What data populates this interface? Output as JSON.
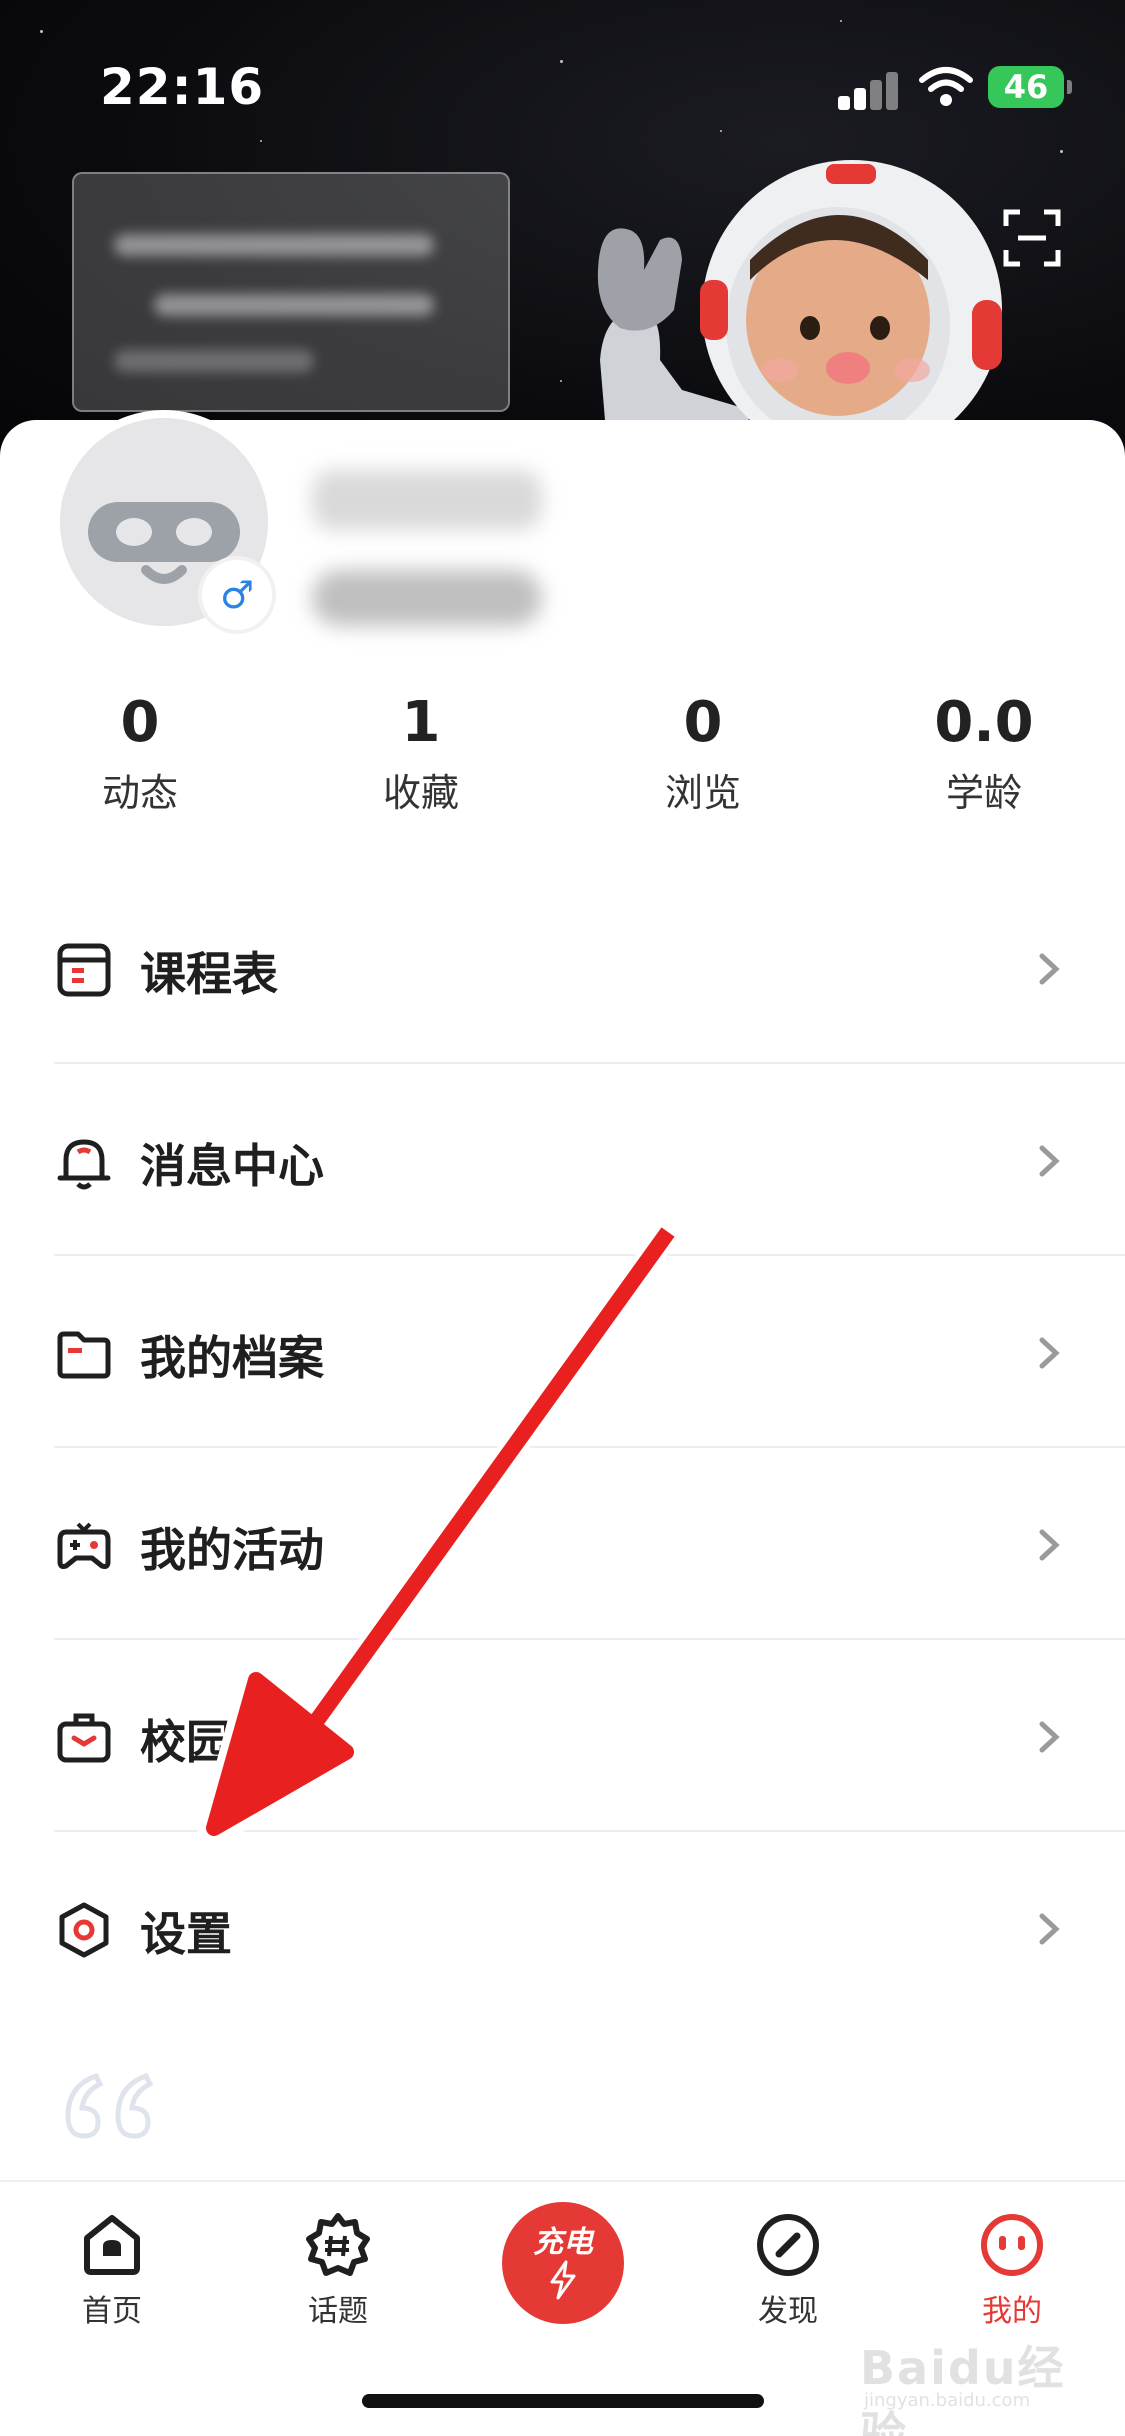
{
  "status_bar": {
    "time": "22:16",
    "battery": "46"
  },
  "profile": {
    "gender_symbol": "♂"
  },
  "stats": [
    {
      "value": "0",
      "label": "动态"
    },
    {
      "value": "1",
      "label": "收藏"
    },
    {
      "value": "0",
      "label": "浏览"
    },
    {
      "value": "0.0",
      "label": "学龄"
    }
  ],
  "menu": [
    {
      "label": "课程表",
      "icon": "schedule-icon"
    },
    {
      "label": "消息中心",
      "icon": "bell-icon"
    },
    {
      "label": "我的档案",
      "icon": "folder-icon"
    },
    {
      "label": "我的活动",
      "icon": "gamepad-icon"
    },
    {
      "label": "校园招聘",
      "icon": "briefcase-icon"
    },
    {
      "label": "设置",
      "icon": "settings-hexagon-icon"
    }
  ],
  "tabbar": {
    "home": "首页",
    "topics": "话题",
    "charge": "充电",
    "discover": "发现",
    "mine": "我的"
  },
  "colors": {
    "accent": "#e53935",
    "battery": "#35c759",
    "gender": "#2a82e4"
  },
  "watermark": {
    "text": "Baidu经验",
    "sub": "jingyan.baidu.com"
  }
}
